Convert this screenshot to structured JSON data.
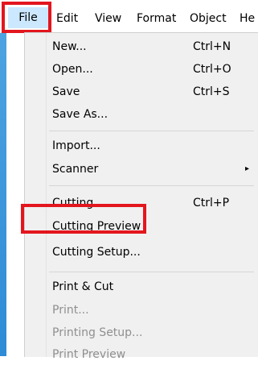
{
  "menubar": {
    "items": [
      {
        "label": "File"
      },
      {
        "label": "Edit"
      },
      {
        "label": "View"
      },
      {
        "label": "Format"
      },
      {
        "label": "Object"
      },
      {
        "label": "He"
      }
    ]
  },
  "file_menu": {
    "items": [
      {
        "label": "New...",
        "shortcut": "Ctrl+N"
      },
      {
        "label": "Open...",
        "shortcut": "Ctrl+O"
      },
      {
        "label": "Save",
        "shortcut": "Ctrl+S"
      },
      {
        "label": "Save As..."
      },
      {
        "label": "Import..."
      },
      {
        "label": "Scanner",
        "submenu_arrow": "▸"
      },
      {
        "label": "Cutting...",
        "shortcut": "Ctrl+P"
      },
      {
        "label": "Cutting Preview"
      },
      {
        "label": "Cutting Setup..."
      },
      {
        "label": "Print & Cut"
      },
      {
        "label": "Print..."
      },
      {
        "label": "Printing Setup..."
      },
      {
        "label": "Print Preview"
      }
    ]
  },
  "colors": {
    "highlight_border": "#e3161e",
    "active_menu_bg": "#cce8ff",
    "disabled_text": "#8f8f8f"
  }
}
